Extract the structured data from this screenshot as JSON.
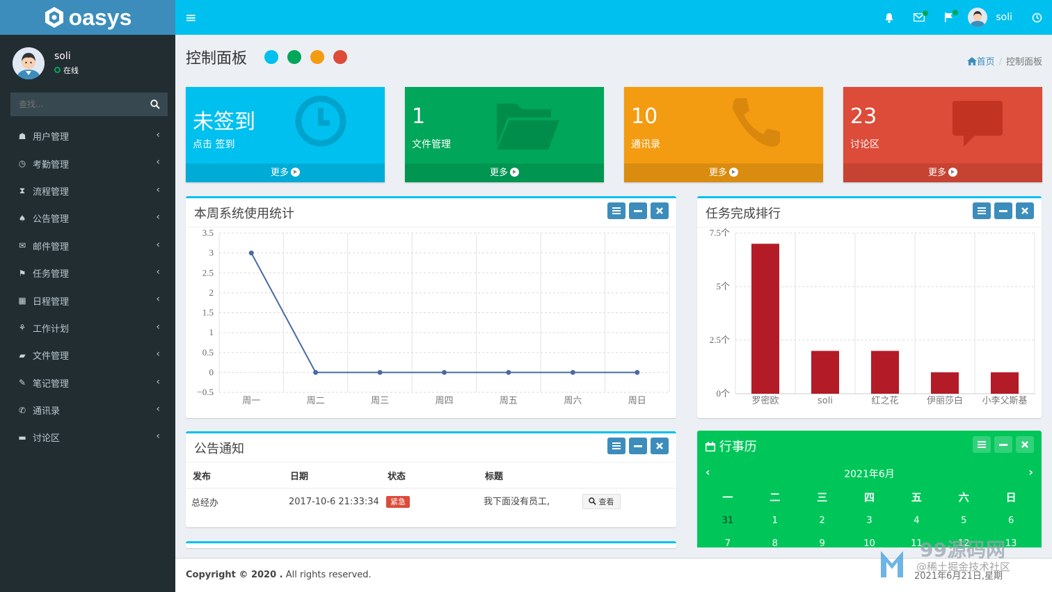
{
  "header": {
    "logo_text": "oasys",
    "user_name": "soli"
  },
  "sidebar": {
    "user": {
      "name": "soli",
      "status": "在线"
    },
    "search_placeholder": "查找...",
    "items": [
      {
        "label": "用户管理",
        "icon": "graduation-cap-icon"
      },
      {
        "label": "考勤管理",
        "icon": "clock-icon"
      },
      {
        "label": "流程管理",
        "icon": "hourglass-icon"
      },
      {
        "label": "公告管理",
        "icon": "bell-icon"
      },
      {
        "label": "邮件管理",
        "icon": "envelope-icon"
      },
      {
        "label": "任务管理",
        "icon": "flag-icon"
      },
      {
        "label": "日程管理",
        "icon": "calendar-icon"
      },
      {
        "label": "工作计划",
        "icon": "tree-icon"
      },
      {
        "label": "文件管理",
        "icon": "folder-open-icon"
      },
      {
        "label": "笔记管理",
        "icon": "edit-icon"
      },
      {
        "label": "通讯录",
        "icon": "phone-icon"
      },
      {
        "label": "讨论区",
        "icon": "comment-icon"
      }
    ]
  },
  "page": {
    "title": "控制面板",
    "skin_colors": [
      "#00c0ef",
      "#00a65a",
      "#f39c12",
      "#dd4b39"
    ],
    "breadcrumb": {
      "home": "首页",
      "current": "控制面板"
    }
  },
  "small_boxes": [
    {
      "big": "未签到",
      "sub": "点击  签到",
      "footer": "更多",
      "color": "#00c0ef",
      "icon": "clock-icon"
    },
    {
      "big": "1",
      "sub": "文件管理",
      "footer": "更多",
      "color": "#00a65a",
      "icon": "folder-open-icon"
    },
    {
      "big": "10",
      "sub": "通讯录",
      "footer": "更多",
      "color": "#f39c12",
      "icon": "phone-icon"
    },
    {
      "big": "23",
      "sub": "讨论区",
      "footer": "更多",
      "color": "#dd4b39",
      "icon": "comment-icon"
    }
  ],
  "usage_box": {
    "title": "本周系统使用统计"
  },
  "rank_box": {
    "title": "任务完成排行"
  },
  "notice_box": {
    "title": "公告通知",
    "columns": [
      "发布",
      "日期",
      "状态",
      "标题"
    ],
    "rows": [
      {
        "publisher": "总经办",
        "date": "2017-10-6 21:33:34",
        "status": "紧急",
        "title": "我下面没有员工,",
        "action": "查看"
      }
    ]
  },
  "calendar": {
    "title": "行事历",
    "month": "2021年6月",
    "weekdays": [
      "一",
      "二",
      "三",
      "四",
      "五",
      "六",
      "日"
    ],
    "weeks": [
      [
        "31",
        "1",
        "2",
        "3",
        "4",
        "5",
        "6"
      ],
      [
        "7",
        "8",
        "9",
        "10",
        "11",
        "12",
        "13"
      ]
    ]
  },
  "footer": {
    "copyright_bold": "Copyright © 2020 .",
    "copyright_rest": " All rights reserved.",
    "watermark_main": "99源码网",
    "watermark_sub": "@稀土掘金技术社区",
    "watermark_date": "2021年6月21日,星期"
  },
  "chart_data": [
    {
      "type": "line",
      "categories": [
        "周一",
        "周二",
        "周三",
        "周四",
        "周五",
        "周六",
        "周日"
      ],
      "series": [
        {
          "values": [
            3,
            0,
            0,
            0,
            0,
            0,
            0
          ]
        }
      ],
      "ylim": [
        -0.5,
        3.5
      ],
      "yticks": [
        "3.5",
        "3",
        "2.5",
        "2",
        "1.5",
        "1",
        "0.5",
        "0",
        "−0.5"
      ],
      "color": "#4a6aa5",
      "grid": true
    },
    {
      "type": "bar",
      "categories": [
        "罗密欧",
        "soli",
        "红之花",
        "伊丽莎白",
        "小李父斯基"
      ],
      "values": [
        7,
        2,
        2,
        1,
        1
      ],
      "ylim": [
        0,
        7.5
      ],
      "yticks": [
        "7.5个",
        "5个",
        "2.5个",
        "0个"
      ],
      "color": "#b31b27",
      "grid": true
    }
  ]
}
